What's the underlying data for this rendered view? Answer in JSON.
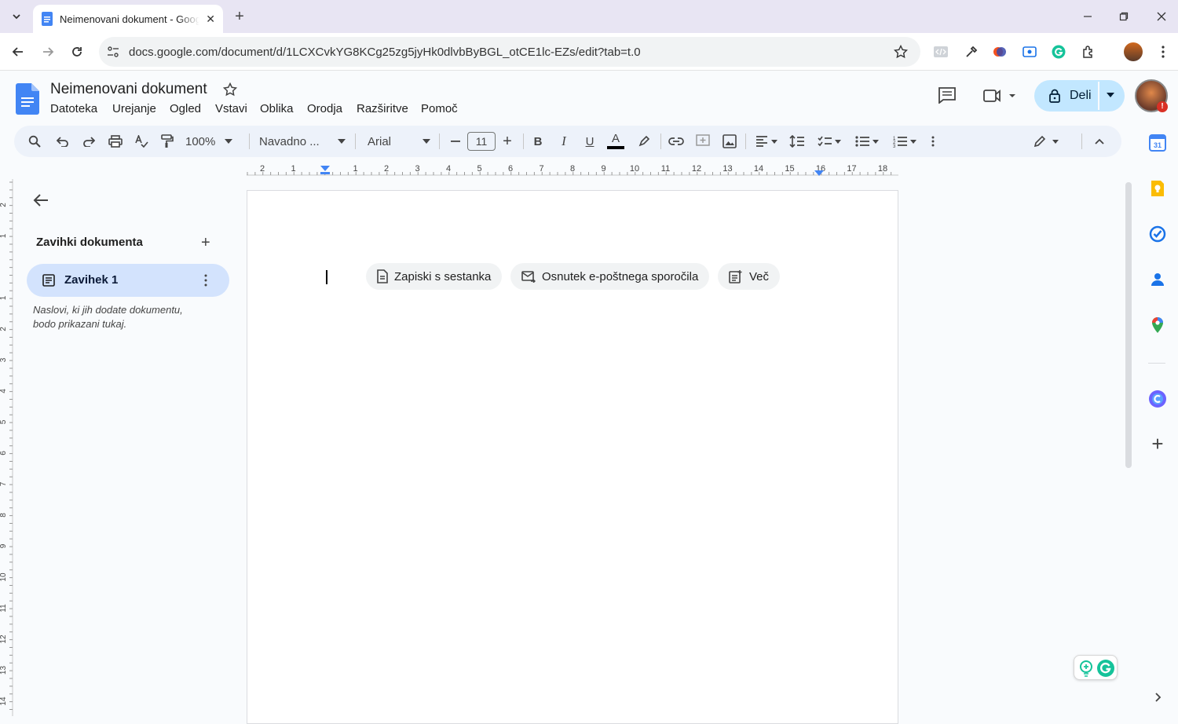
{
  "browser": {
    "tab_title": "Neimenovani dokument - Goog",
    "url": "docs.google.com/document/d/1LCXCvkYG8KCg25zg5jyHk0dlvbByBGL_otCE1lc-EZs/edit?tab=t.0"
  },
  "docs": {
    "title": "Neimenovani dokument",
    "menu": [
      "Datoteka",
      "Urejanje",
      "Ogled",
      "Vstavi",
      "Oblika",
      "Orodja",
      "Razširitve",
      "Pomoč"
    ],
    "share_label": "Deli"
  },
  "toolbar": {
    "zoom": "100%",
    "style": "Navadno ...",
    "font": "Arial",
    "font_size": "11",
    "bold": "B",
    "italic": "I",
    "underline": "U",
    "text_color": "A"
  },
  "ruler": {
    "labels": [
      "2",
      "1",
      "1",
      "2",
      "3",
      "4",
      "5",
      "6",
      "7",
      "8",
      "9",
      "10",
      "11",
      "12",
      "13",
      "14",
      "15",
      "16",
      "17",
      "18"
    ],
    "vlabels": [
      "2",
      "1",
      "1",
      "2",
      "3",
      "4",
      "5",
      "6",
      "7",
      "8",
      "9",
      "10",
      "11",
      "12",
      "13",
      "14"
    ]
  },
  "outline": {
    "heading": "Zavihki dokumenta",
    "tab_label": "Zavihek 1",
    "hint": "Naslovi, ki jih dodate dokumentu, bodo prikazani tukaj."
  },
  "page": {
    "chips": [
      {
        "label": "Zapiski s sestanka",
        "icon": "document-icon"
      },
      {
        "label": "Osnutek e-poštnega sporočila",
        "icon": "email-draft-icon"
      },
      {
        "label": "Več",
        "icon": "more-templates-icon"
      }
    ]
  },
  "colors": {
    "accent": "#0b57d0",
    "share_bg": "#c2e7ff",
    "tab_active_bg": "#d3e3fd",
    "toolbar_bg": "#edf2fa"
  }
}
